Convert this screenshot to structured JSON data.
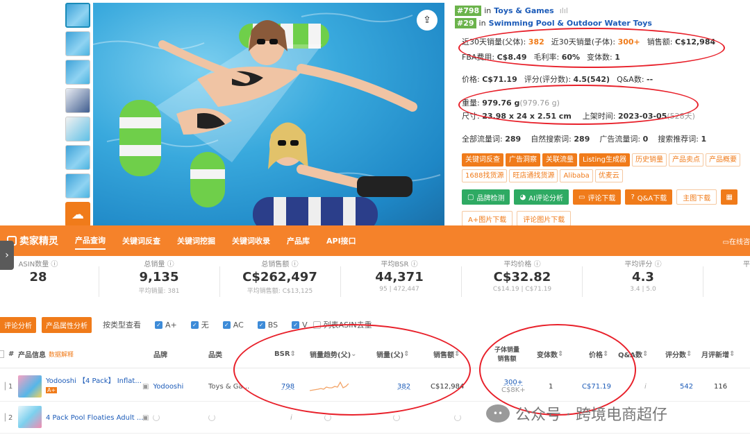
{
  "product": {
    "rank1": {
      "num": "#798",
      "label": "in",
      "cat": "Toys & Games"
    },
    "rank2": {
      "num": "#29",
      "label": "in",
      "cat": "Swimming Pool & Outdoor Water Toys"
    },
    "sales30_parent_label": "近30天销量(父体):",
    "sales30_parent": "382",
    "sales30_child_label": "近30天销量(子体):",
    "sales30_child": "300+",
    "revenue_label": "销售额:",
    "revenue": "C$12,984",
    "fba_label": "FBA费用:",
    "fba": "C$8.49",
    "margin_label": "毛利率:",
    "margin": "60%",
    "variants_label": "变体数:",
    "variants": "1",
    "price_label": "价格:",
    "price": "C$71.19",
    "rating_label": "评分(评分数):",
    "rating": "4.5(542)",
    "qa_label": "Q&A数:",
    "qa": "--",
    "weight_label": "重量:",
    "weight": "979.76 g",
    "weight2": "(979.76 g)",
    "size_label": "尺寸:",
    "size": "23.98 x 24 x 2.51 cm",
    "date_label": "上架时间:",
    "date": "2023-03-05",
    "days": "(528天)",
    "traffic": [
      {
        "label": "全部流量词:",
        "val": "289"
      },
      {
        "label": "自然搜索词:",
        "val": "289"
      },
      {
        "label": "广告流量词:",
        "val": "0"
      },
      {
        "label": "搜索推荐词:",
        "val": "1"
      }
    ],
    "tags_row1": [
      "关键词反查",
      "广告洞察",
      "关联流量",
      "Listing生成器",
      "历史销量",
      "产品卖点",
      "产品概要"
    ],
    "tags_row2": [
      "1688找货源",
      "旺店通找货源",
      "Alibaba",
      "优麦云"
    ],
    "actions": [
      "品牌检测",
      "AI评论分析",
      "评论下载",
      "Q&A下载",
      "主图下载"
    ],
    "actions2": [
      "A+图片下载",
      "评论图片下载"
    ]
  },
  "nav": {
    "logo": "卖家精灵",
    "items": [
      "产品查询",
      "关键词反查",
      "关键词挖掘",
      "关键词收录",
      "产品库",
      "API接口"
    ],
    "right": "在线咨"
  },
  "stats": [
    {
      "label": "ASIN数量",
      "value": "28",
      "sub": ""
    },
    {
      "label": "总销量",
      "value": "9,135",
      "sub": "平均销量: 381"
    },
    {
      "label": "总销售额",
      "value": "C$262,497",
      "sub": "平均销售额: C$13,125"
    },
    {
      "label": "平均BSR",
      "value": "44,371",
      "sub": "95 | 472,447"
    },
    {
      "label": "平均价格",
      "value": "C$32.82",
      "sub": "C$14.19 | C$71.19"
    },
    {
      "label": "平均评分",
      "value": "4.3",
      "sub": "3.4 | 5.0"
    },
    {
      "label": "平",
      "value": "",
      "sub": ""
    }
  ],
  "filters": {
    "btn1": "评论分析",
    "btn2": "产品属性分析",
    "type_label": "按类型查看",
    "checks": [
      "A+",
      "无",
      "AC",
      "BS",
      "V"
    ],
    "dedupe": "列表ASIN去重"
  },
  "table": {
    "headers": {
      "hash": "#",
      "info": "产品信息",
      "note": "数据解释",
      "brand": "品牌",
      "category": "品类",
      "bsr": "BSR",
      "trend": "销量趋势(父)",
      "sales": "销量(父)",
      "revenue": "销售额",
      "child1": "子体销量",
      "child2": "销售额",
      "variants": "变体数",
      "price": "价格",
      "qa": "Q&A数",
      "rating": "评分数",
      "monthly": "月评新增"
    },
    "rows": [
      {
        "idx": "1",
        "title": "Yodooshi 【4 Pack】 Inflat...",
        "badge": "A+",
        "brand": "Yodooshi",
        "category": "Toys & Ga...",
        "bsr": "798",
        "sales": "382",
        "revenue": "C$12,984",
        "child_sales": "300+",
        "child_rev": "C$8K+",
        "variants": "1",
        "price": "C$71.19",
        "qa": "i",
        "rating": "542",
        "monthly": "116"
      },
      {
        "idx": "2",
        "title": "4 Pack Pool Floaties Adult ...",
        "badge": "",
        "brand": "",
        "category": "",
        "bsr": "",
        "sales": "",
        "revenue": "",
        "child_sales": "",
        "child_rev": "",
        "variants": "",
        "price": "",
        "qa": "",
        "rating": "",
        "monthly": ""
      }
    ]
  },
  "watermark": "公众号 · 跨境电商超仔"
}
